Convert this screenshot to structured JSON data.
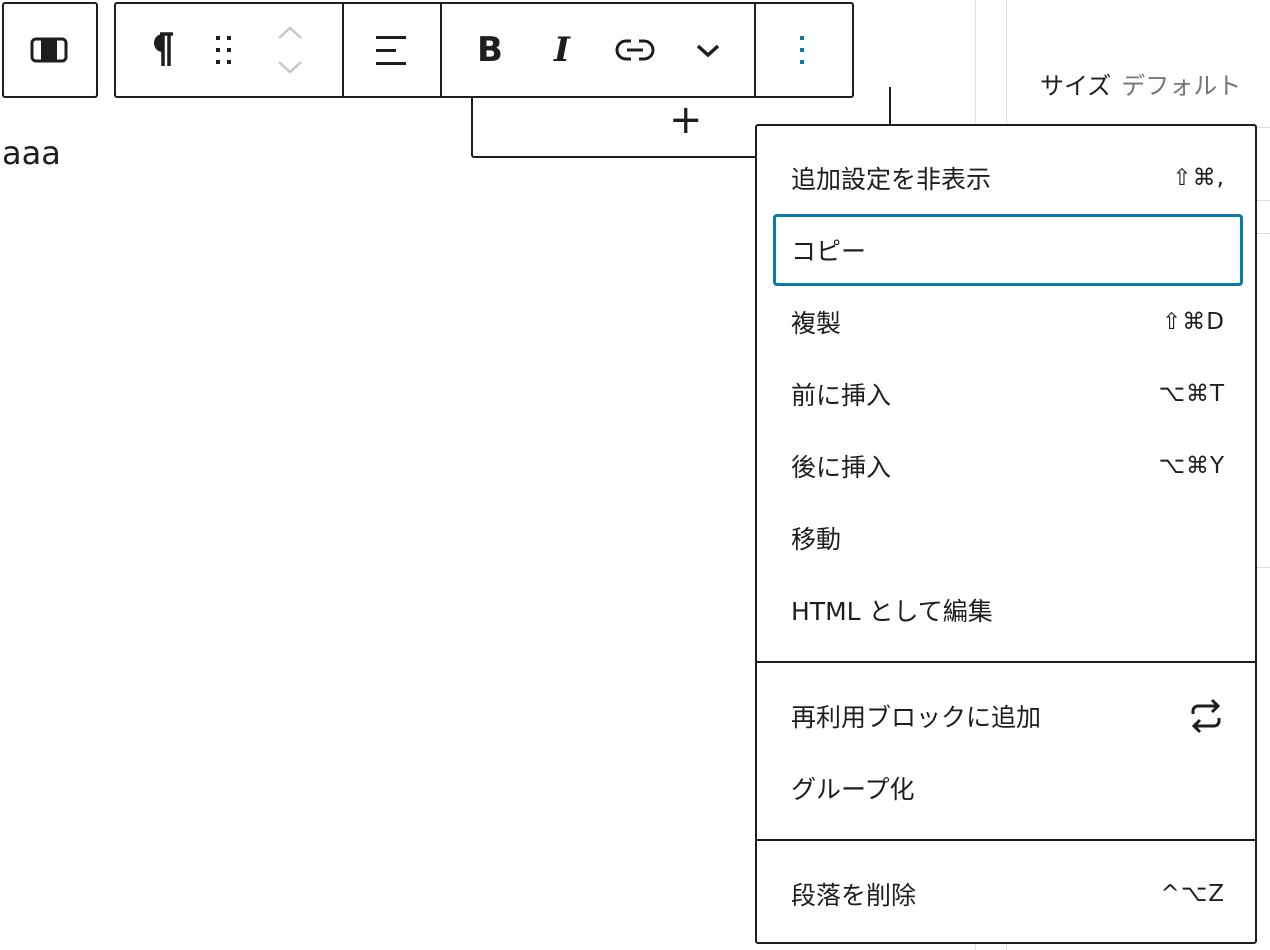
{
  "sidebar": {
    "size_label": "サイズ",
    "size_value": "デフォルト"
  },
  "toolbar": {
    "transform_icon": "block-transform-icon",
    "paragraph_icon": "pilcrow-icon",
    "drag_icon": "drag-handle-icon",
    "move_icon": "move-up-down-icon",
    "align_icon": "align-left-icon",
    "bold_label": "B",
    "italic_label": "I",
    "link_icon": "link-icon",
    "more_icon": "chevron-down-icon",
    "options_icon": "more-vertical-icon",
    "options_color": "#0a7aa9"
  },
  "inserter": {
    "label": "+"
  },
  "editor": {
    "paragraph_text": "aaa"
  },
  "menu": {
    "sections": [
      {
        "items": [
          {
            "label": "追加設定を非表示",
            "shortcut": "⇧⌘,"
          },
          {
            "label": "コピー",
            "shortcut": "",
            "focused": true
          },
          {
            "label": "複製",
            "shortcut": "⇧⌘D"
          },
          {
            "label": "前に挿入",
            "shortcut": "⌥⌘T"
          },
          {
            "label": "後に挿入",
            "shortcut": "⌥⌘Y"
          },
          {
            "label": "移動",
            "shortcut": ""
          },
          {
            "label": "HTML として編集",
            "shortcut": ""
          }
        ]
      },
      {
        "items": [
          {
            "label": "再利用ブロックに追加",
            "icon": "reusable-block-icon"
          },
          {
            "label": "グループ化",
            "shortcut": ""
          }
        ]
      },
      {
        "items": [
          {
            "label": "段落を削除",
            "shortcut": "^⌥Z"
          }
        ]
      }
    ]
  },
  "colors": {
    "text": "#1e1e1e",
    "muted": "#757575",
    "focus": "#0a7aa9",
    "disabled": "#c7c7c7"
  }
}
